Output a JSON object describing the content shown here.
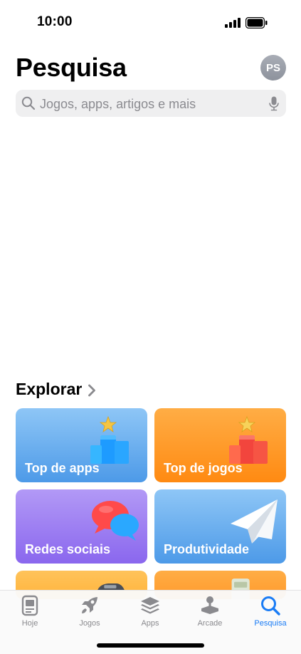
{
  "status_bar": {
    "time": "10:00"
  },
  "header": {
    "title": "Pesquisa",
    "avatar_initials": "PS"
  },
  "search": {
    "placeholder": "Jogos, apps, artigos e mais"
  },
  "explore": {
    "title": "Explorar",
    "cards": [
      {
        "label": "Top de apps"
      },
      {
        "label": "Top de jogos"
      },
      {
        "label": "Redes sociais"
      },
      {
        "label": "Produtividade"
      },
      {
        "label": ""
      },
      {
        "label": ""
      }
    ]
  },
  "tab_bar": {
    "tabs": [
      {
        "label": "Hoje",
        "icon": "today-icon"
      },
      {
        "label": "Jogos",
        "icon": "rocket-icon"
      },
      {
        "label": "Apps",
        "icon": "layers-icon"
      },
      {
        "label": "Arcade",
        "icon": "joystick-icon"
      },
      {
        "label": "Pesquisa",
        "icon": "search-icon"
      }
    ],
    "active_index": 4,
    "active_color": "#1a7cf5",
    "inactive_color": "#8a8a8e"
  }
}
